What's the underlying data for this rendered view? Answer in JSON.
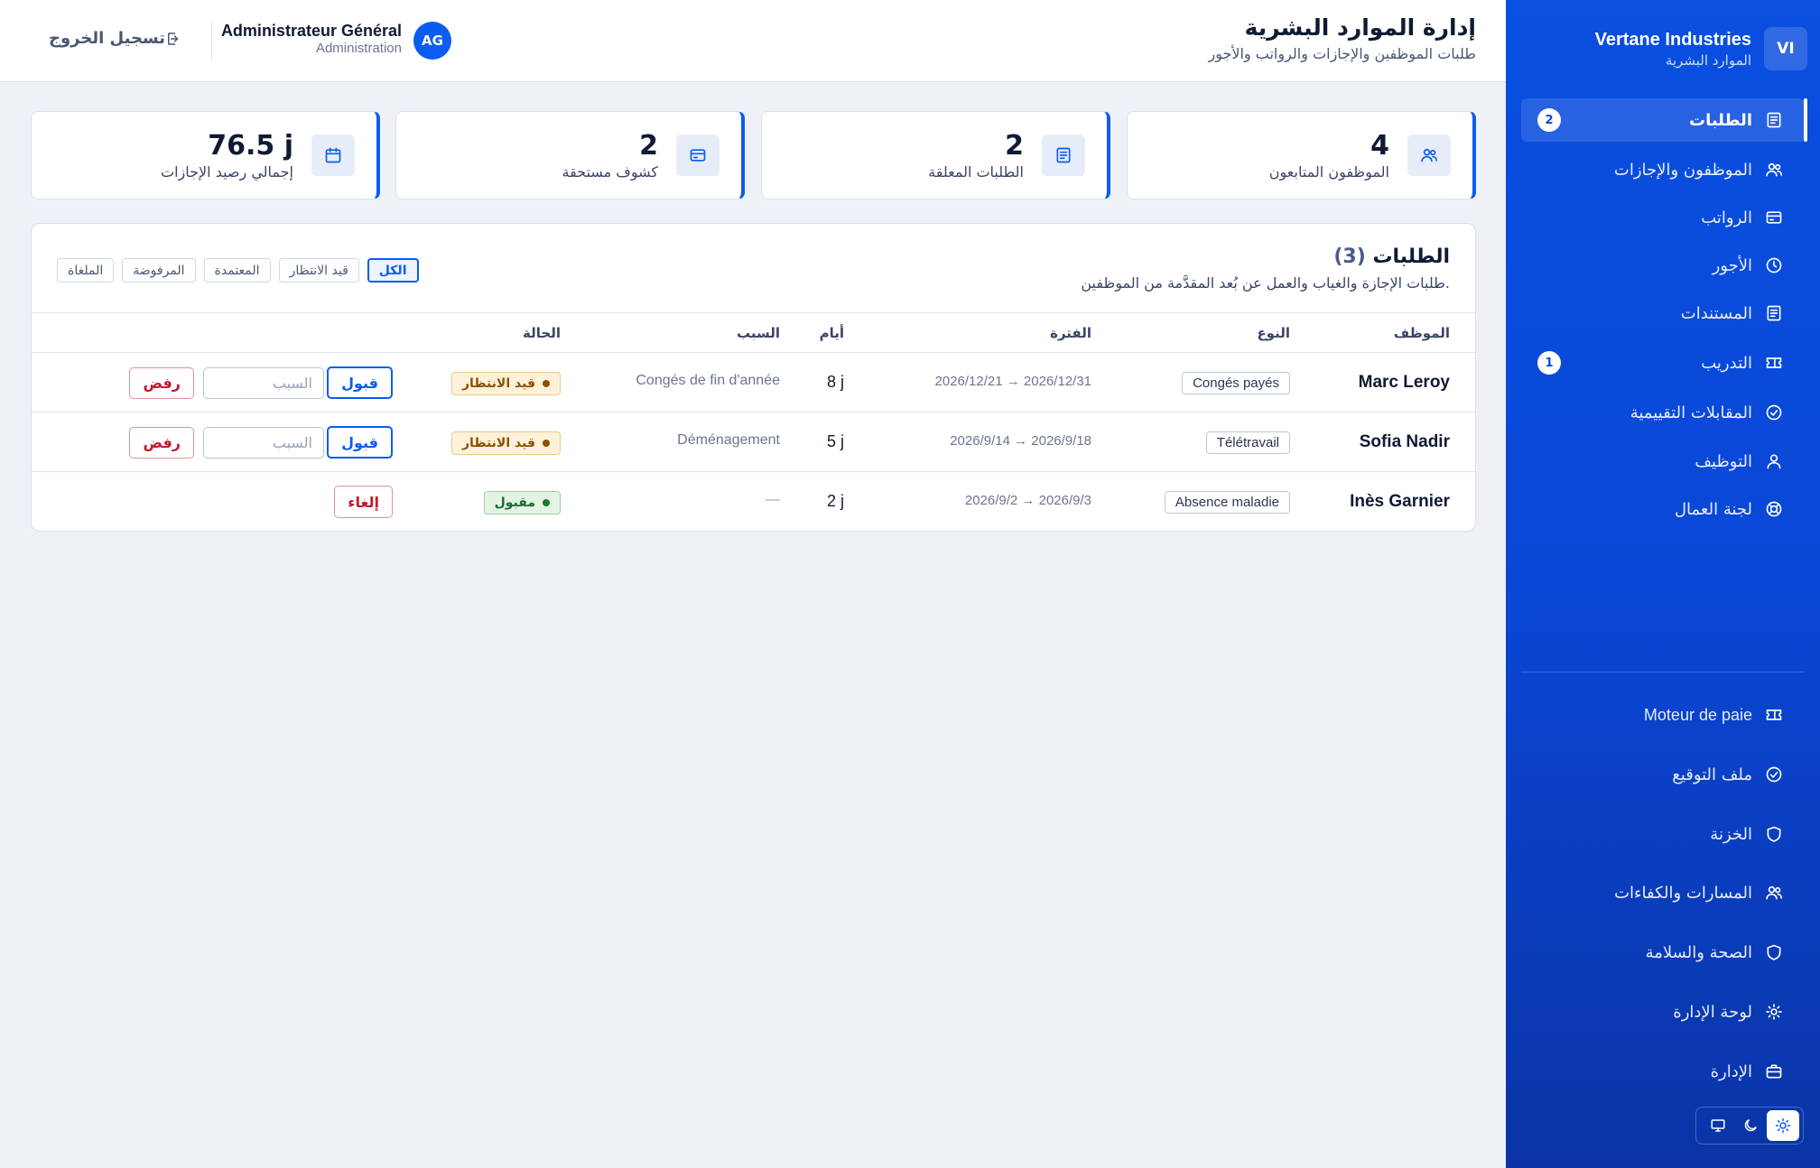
{
  "brand": {
    "badge": "VI",
    "name": "Vertane Industries",
    "subtitle": "الموارد البشرية"
  },
  "nav": {
    "primary": [
      {
        "label": "الطلبات",
        "badge": "2",
        "icon": "document-list-icon",
        "active": true
      },
      {
        "label": "الموظفون والإجازات",
        "icon": "users-icon"
      },
      {
        "label": "الرواتب",
        "icon": "credit-card-icon"
      },
      {
        "label": "الأجور",
        "icon": "clock-icon"
      },
      {
        "label": "المستندات",
        "icon": "document-list-icon"
      },
      {
        "label": "التدريب",
        "badge": "1",
        "icon": "ticket-icon"
      },
      {
        "label": "المقابلات التقييمية",
        "icon": "check-circle-icon"
      },
      {
        "label": "التوظيف",
        "icon": "user-icon"
      },
      {
        "label": "لجنة العمال",
        "icon": "lifebuoy-icon"
      }
    ],
    "secondary": [
      {
        "label": "Moteur de paie",
        "icon": "ticket-icon"
      },
      {
        "label": "ملف التوقيع",
        "icon": "check-circle-icon"
      },
      {
        "label": "الخزنة",
        "icon": "shield-icon"
      },
      {
        "label": "المسارات والكفاءات",
        "icon": "users-icon"
      },
      {
        "label": "الصحة والسلامة",
        "icon": "shield-icon"
      },
      {
        "label": "لوحة الإدارة",
        "icon": "sun-gear-icon"
      },
      {
        "label": "الإدارة",
        "icon": "briefcase-icon"
      }
    ]
  },
  "theme": {
    "options": [
      "light",
      "dark",
      "system"
    ],
    "selected": "light"
  },
  "header": {
    "title": "إدارة الموارد البشرية",
    "subtitle": "طلبات الموظفين والإجازات والرواتب والأجور",
    "user_initials": "AG",
    "user_name": "Administrateur Général",
    "user_role": "Administration",
    "logout_label": "تسجيل الخروج"
  },
  "stats": [
    {
      "value": "4",
      "label": "الموظفون المتابعون",
      "icon": "users-icon"
    },
    {
      "value": "2",
      "label": "الطلبات المعلقة",
      "icon": "document-list-icon"
    },
    {
      "value": "2",
      "label": "كشوف مستحقة",
      "icon": "credit-card-icon"
    },
    {
      "value": "76.5 j",
      "label": "إجمالي رصيد الإجازات",
      "icon": "calendar-icon"
    }
  ],
  "requests": {
    "title": "الطلبات",
    "count": "(3)",
    "subtitle": "طلبات الإجازة والغياب والعمل عن بُعد المقدَّمة من الموظفين.",
    "filters": [
      "الكل",
      "قيد الانتظار",
      "المعتمدة",
      "المرفوضة",
      "الملغاة"
    ],
    "active_filter": "الكل",
    "columns": {
      "employee": "الموظف",
      "type": "النوع",
      "period": "الفترة",
      "days": "أيام",
      "reason": "السبب",
      "status": "الحالة"
    },
    "rows": [
      {
        "employee": "Marc Leroy",
        "type": "Congés payés",
        "period": "2026/12/21 → 2026/12/31",
        "days": "8 j",
        "reason": "Congés de fin d'année",
        "status": "قيد الانتظار",
        "status_kind": "pending",
        "accept_label": "قبول",
        "reason_placeholder": "السبب",
        "reject_label": "رفض"
      },
      {
        "employee": "Sofia Nadir",
        "type": "Télétravail",
        "period": "2026/9/14 → 2026/9/18",
        "days": "5 j",
        "reason": "Déménagement",
        "status": "قيد الانتظار",
        "status_kind": "pending",
        "accept_label": "قبول",
        "reason_placeholder": "السبب",
        "reject_label": "رفض"
      },
      {
        "employee": "Inès Garnier",
        "type": "Absence maladie",
        "period": "2026/9/2 → 2026/9/3",
        "days": "2 j",
        "reason": "—",
        "status": "مقبول",
        "status_kind": "approved",
        "cancel_label": "إلغاء"
      }
    ]
  },
  "colors": {
    "primary": "#0b5cf0",
    "sidebar": "#0a47d6",
    "pending": "#8a5200",
    "approved": "#1b6b2a",
    "danger": "#c21b2e"
  }
}
